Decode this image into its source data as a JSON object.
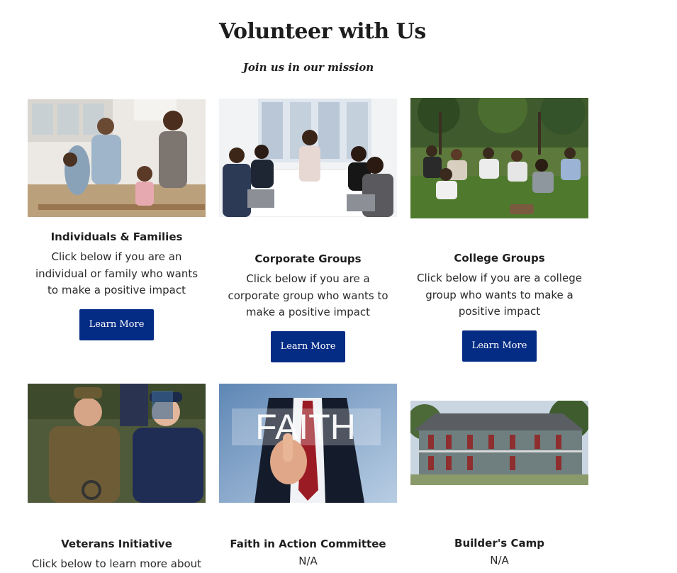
{
  "header": {
    "title": "Volunteer with Us",
    "subtitle": "Join us in our mission"
  },
  "cards": [
    {
      "title": "Individuals & Families",
      "description": "Click below if you are an individual or family who wants to make a positive impact",
      "button": "Learn More",
      "image": "family-cooking-photo"
    },
    {
      "title": "Corporate Groups",
      "description": "Click below if you are a corporate group who wants to make a positive impact",
      "button": "Learn More",
      "image": "office-team-photo"
    },
    {
      "title": "College Groups",
      "description": "Click below if you are a college group who wants to make a positive impact",
      "button": "Learn More",
      "image": "students-on-lawn-photo"
    },
    {
      "title": "Veterans Initiative",
      "description": "Click below to learn more about",
      "image": "veterans-photo"
    },
    {
      "title": "Faith in Action Committee",
      "description": "N/A",
      "image": "faith-touchscreen-photo",
      "image_text": "FAITH"
    },
    {
      "title": "Builder's Camp",
      "description": "N/A",
      "image": "wooden-house-photo"
    }
  ],
  "colors": {
    "button_bg": "#052c85",
    "button_text": "#ffffff",
    "heading_text": "#1d1d1d"
  }
}
